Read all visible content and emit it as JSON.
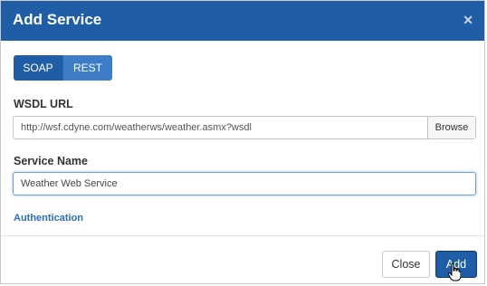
{
  "dialog": {
    "title": "Add Service",
    "close_icon": "close-icon",
    "tabs": [
      {
        "label": "SOAP",
        "selected": true
      },
      {
        "label": "REST",
        "selected": false
      }
    ],
    "wsdl": {
      "label": "WSDL URL",
      "value": "http://wsf.cdyne.com/weatherws/weather.asmx?wsdl",
      "browse_label": "Browse"
    },
    "service": {
      "label": "Service Name",
      "value": "Weather Web Service"
    },
    "auth_link": "Authentication",
    "footer": {
      "close_label": "Close",
      "add_label": "Add"
    },
    "colors": {
      "header": "#1f5ea6",
      "accent": "#2a6ebb"
    }
  }
}
